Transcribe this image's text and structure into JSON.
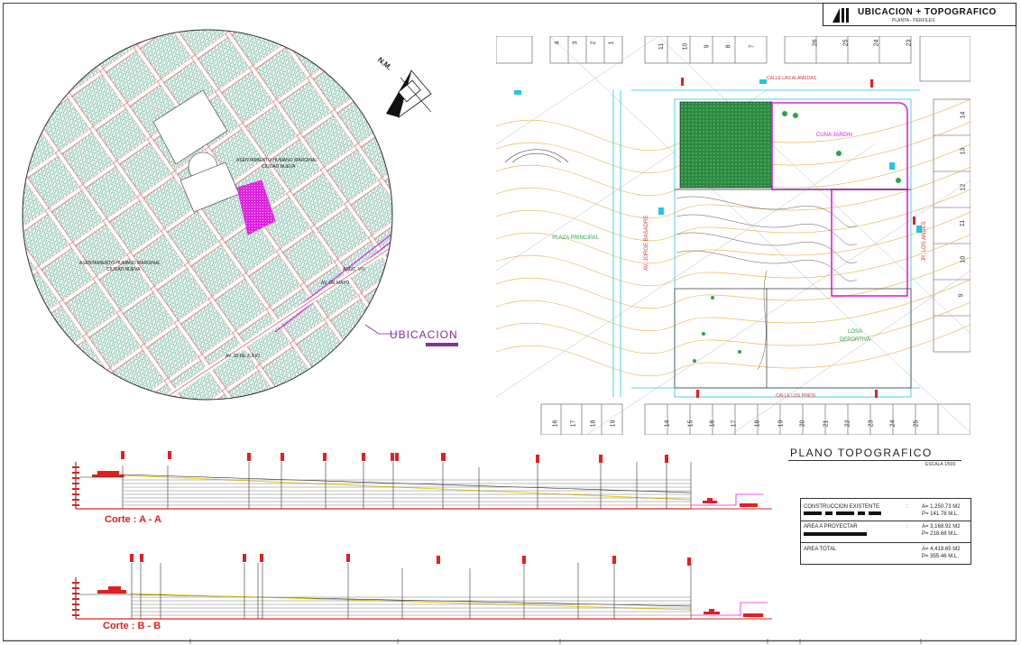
{
  "title_block": {
    "title": "UBICACION + TOPOGRAFICO",
    "subtitle": "PLANTA - PERFILES"
  },
  "location_map": {
    "north_label": "N.M.",
    "labels": {
      "ah1": "ASENTAMIENTO HUMANO MARGINAL",
      "ah1b": "CIUDAD NUEVA",
      "ah2": "ASENTAMIENTO HUMANO MARGINAL",
      "ah2b": "CIUDAD NUEVA",
      "assoc": "ASOC. VIV",
      "street1": "AV. 28 DE JULIO",
      "street2": "AV. DE MAYO"
    },
    "caption": "UBICACION"
  },
  "topo_plan": {
    "zone_labels": {
      "plaza": "PLAZA PRINCIPAL",
      "cuna": "CUNA JARDIN",
      "losa": "LOSA DEPORTIVA"
    },
    "lot_numbers_top": [
      "4",
      "3",
      "2",
      "1",
      "11",
      "10",
      "9",
      "8",
      "7",
      "26",
      "25",
      "24",
      "23"
    ],
    "lot_numbers_bottom": [
      "16",
      "17",
      "18",
      "19",
      "14",
      "15",
      "16",
      "17",
      "18",
      "19",
      "20",
      "21",
      "22",
      "23",
      "24",
      "25"
    ],
    "lot_numbers_right": [
      "14",
      "13",
      "12",
      "11",
      "10",
      "9"
    ],
    "title": "PLANO TOPOGRAFICO",
    "scale": "ESCALA 1/500"
  },
  "areas": {
    "rows": [
      {
        "label": "CONSTRUCCION EXISTENTE",
        "colon": ":",
        "area": "A= 1,250.73 M2",
        "perimeter": "P= 141.78 M.L."
      },
      {
        "label": "AREA A PROYECTAR",
        "colon": ":",
        "area": "A= 3,168.92 M2",
        "perimeter": "P= 218.68 M.L."
      },
      {
        "label": "AREA TOTAL",
        "colon": ":",
        "area": "A= 4,419.65 M2",
        "perimeter": "P= 355.46 M.L."
      }
    ]
  },
  "sections": {
    "a": "Corte : A - A",
    "b": "Corte : B - B"
  },
  "colors": {
    "magenta": "#e020e0",
    "red": "#e02020",
    "green": "#2aa44a",
    "cyan": "#20c8e0",
    "contour": "#e8b040",
    "purple": "#8a2c9b"
  }
}
